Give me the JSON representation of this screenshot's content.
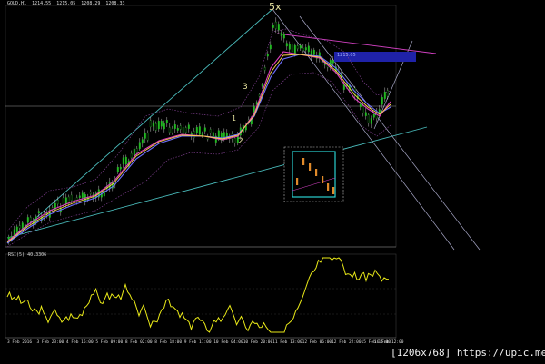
{
  "header": {
    "symbol": "GOLD,H1",
    "quote": "1214.55  1215.05  1208.29  1208.33"
  },
  "rsi_label": "RSI(5) 40.3306",
  "footer": "[1206x768] https://upic.me/",
  "wave_labels": {
    "w5x": "5x",
    "w3": "3",
    "w1": "1",
    "w2": "2"
  },
  "zone_label": "1215.05",
  "x_axis_labels": [
    "3 Feb 2016",
    "3 Feb 23:00",
    "4 Feb 16:00",
    "5 Feb 09:00",
    "8 Feb 02:00",
    "8 Feb 18:00",
    "9 Feb 11:00",
    "10 Feb 04:00",
    "10 Feb 20:00",
    "11 Feb 13:00",
    "12 Feb 06:00",
    "12 Feb 22:00",
    "15 Feb 15:00",
    "16 Feb 12:00"
  ],
  "colors": {
    "candle": "#22b822",
    "wick": "#e8e8e8",
    "trend": "#48b8b8",
    "channel": "#a8a8c8",
    "pink_line": "#d040c0",
    "zone": "#1f22a8",
    "rsi": "#e8e818",
    "ma_fast": "#e040c0",
    "ma_mid": "#ffd24a",
    "ma_slow": "#6f6fff",
    "bollinger": "#7a3d8a"
  }
}
